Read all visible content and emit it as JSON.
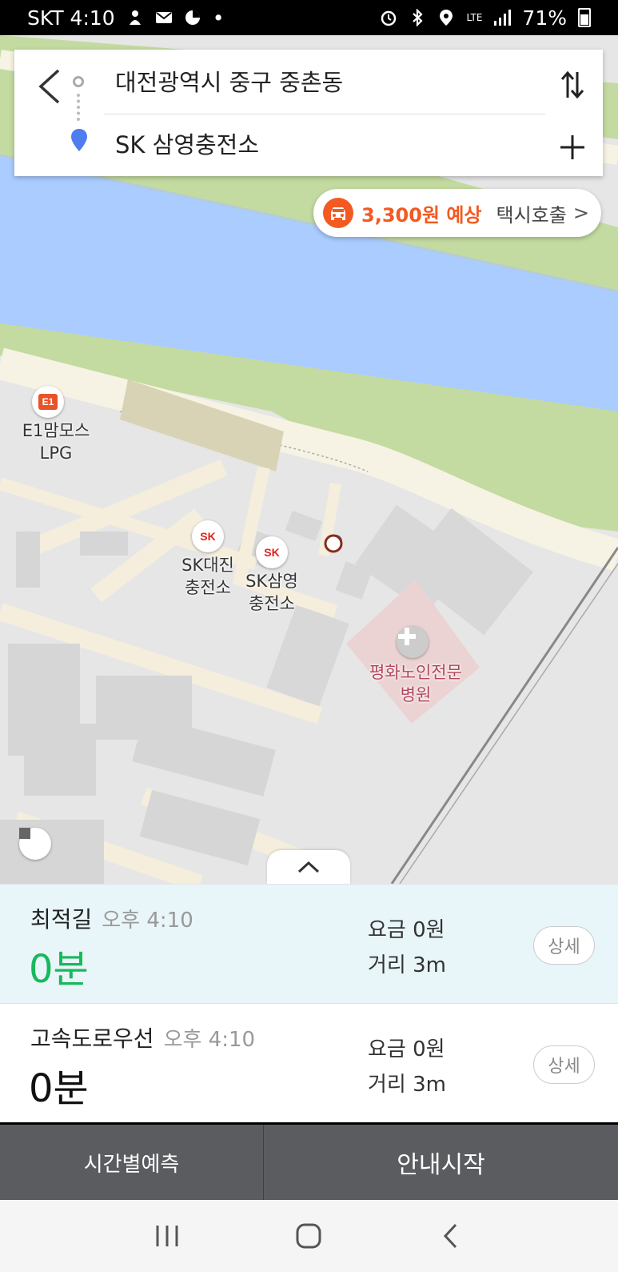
{
  "status_bar": {
    "carrier_time": "SKT 4:10",
    "network": "LTE",
    "battery": "71%"
  },
  "search": {
    "origin": "대전광역시 중구 중촌동",
    "destination": "SK 삼영충전소"
  },
  "taxi": {
    "price": "3,300원 예상",
    "call_label": "택시호출",
    "chevron": ">"
  },
  "map": {
    "labels": {
      "e1_station": "E1맘모스\nLPG",
      "sk_daejin": "SK대진\n충전소",
      "sk_samyoung": "SK삼영\n충전소",
      "hospital": "평화노인전문\n병원"
    },
    "icons": [
      "e1-logo-icon",
      "sk-logo-icon",
      "hospital-cross-icon",
      "current-location-icon"
    ]
  },
  "routes": [
    {
      "name": "최적길",
      "eta": "오후 4:10",
      "time": "0분",
      "fee": "요금 0원",
      "distance": "거리 3m",
      "detail": "상세",
      "color": "#19b85b"
    },
    {
      "name": "고속도로우선",
      "eta": "오후 4:10",
      "time": "0분",
      "fee": "요금 0원",
      "distance": "거리 3m",
      "detail": "상세",
      "color": "#111111"
    }
  ],
  "bottom": {
    "time_prediction": "시간별예측",
    "start_guidance": "안내시작"
  },
  "colors": {
    "accent_orange": "#f25a22",
    "route_green": "#19b85b",
    "river_blue": "#aaccff",
    "park_green": "#c3dba0"
  }
}
